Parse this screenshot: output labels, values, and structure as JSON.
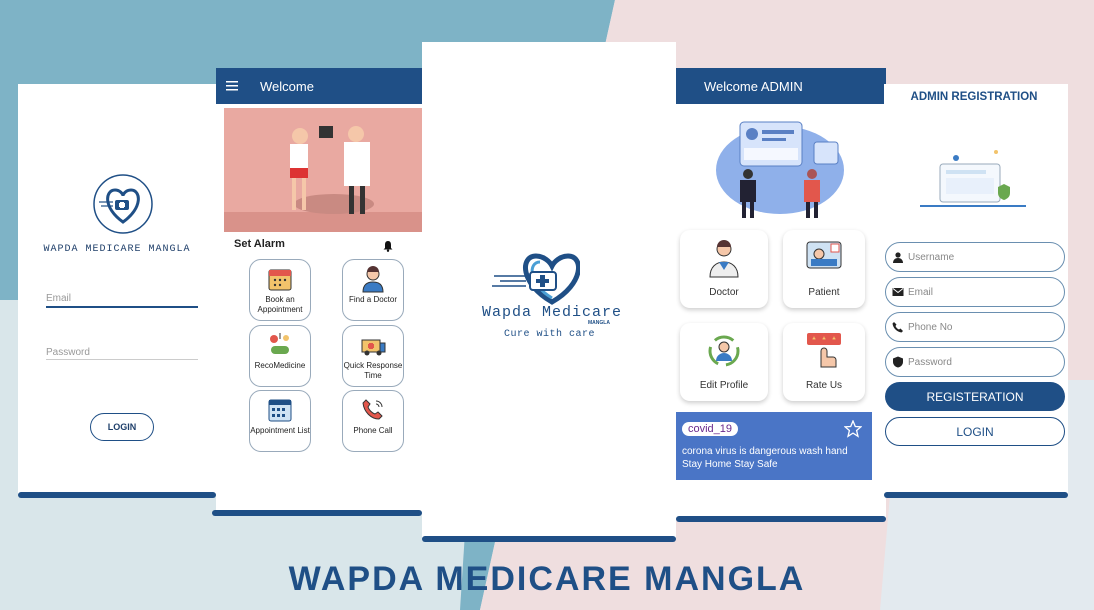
{
  "colors": {
    "primary": "#1f4f86",
    "teal": "#7eb3c6",
    "pink": "#efdedf",
    "covid_card": "#4a75c6"
  },
  "banner": {
    "title": "WAPDA MEDICARE MANGLA"
  },
  "login_screen": {
    "brand": "WAPDA MEDICARE MANGLA",
    "email_placeholder": "Email",
    "password_placeholder": "Password",
    "login_label": "LOGIN"
  },
  "home_screen": {
    "title": "Welcome",
    "set_alarm": "Set Alarm",
    "tiles": [
      {
        "label": "Book an Appointment",
        "icon": "calendar-icon"
      },
      {
        "label": "Find a Doctor",
        "icon": "doctor-icon"
      },
      {
        "label": "RecoMedicine",
        "icon": "pills-icon"
      },
      {
        "label": "Quick Response Time",
        "icon": "ambulance-icon"
      },
      {
        "label": "Appointment List",
        "icon": "calendar-list-icon"
      },
      {
        "label": "Phone Call",
        "icon": "phone-icon"
      }
    ]
  },
  "splash_screen": {
    "brand": "Wapda Medicare",
    "tag": "MANGLA",
    "tagline": "Cure with care"
  },
  "admin_screen": {
    "title": "Welcome ADMIN",
    "cards": [
      {
        "label": "Doctor",
        "icon": "doctor-icon"
      },
      {
        "label": "Patient",
        "icon": "patient-icon"
      },
      {
        "label": "Edit Profile",
        "icon": "profile-icon"
      },
      {
        "label": "Rate Us",
        "icon": "rating-icon"
      }
    ],
    "covid": {
      "chip": "covid_19",
      "line1": "corona virus is dangerous wash hand",
      "line2": "Stay Home Stay Safe"
    }
  },
  "register_screen": {
    "title": "ADMIN REGISTRATION",
    "username_placeholder": "Username",
    "email_placeholder": "Email",
    "phone_placeholder": "Phone No",
    "password_placeholder": "Password",
    "register_label": "REGISTERATION",
    "login_label": "LOGIN"
  }
}
